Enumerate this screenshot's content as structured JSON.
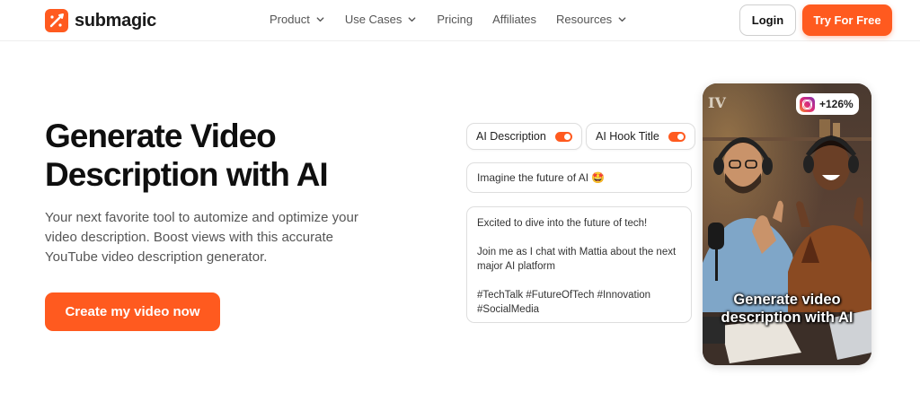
{
  "brand": {
    "name": "submagic",
    "accent": "#ff5a1f"
  },
  "nav": {
    "items": [
      {
        "label": "Product",
        "has_dropdown": true
      },
      {
        "label": "Use Cases",
        "has_dropdown": true
      },
      {
        "label": "Pricing",
        "has_dropdown": false
      },
      {
        "label": "Affiliates",
        "has_dropdown": false
      },
      {
        "label": "Resources",
        "has_dropdown": true
      }
    ],
    "login_label": "Login",
    "try_label": "Try For Free"
  },
  "hero": {
    "title": "Generate Video Description with AI",
    "subtitle": "Your next favorite tool to automize and optimize your video description. Boost views with this accurate YouTube video description generator.",
    "cta_label": "Create my video now"
  },
  "mock": {
    "toggles": [
      {
        "label": "AI Description",
        "on": true
      },
      {
        "label": "AI Hook Title",
        "on": true
      }
    ],
    "prompt": "Imagine the future of AI 🤩",
    "output": [
      "Excited to dive into the future of tech!",
      "Join me as I chat with Mattia about the next major AI platform",
      "#TechTalk #FutureOfTech #Innovation #SocialMedia"
    ]
  },
  "video": {
    "corner_mark": "IV",
    "badge_icon": "instagram-icon",
    "badge_value": "+126%",
    "caption": "Generate video description with AI"
  }
}
